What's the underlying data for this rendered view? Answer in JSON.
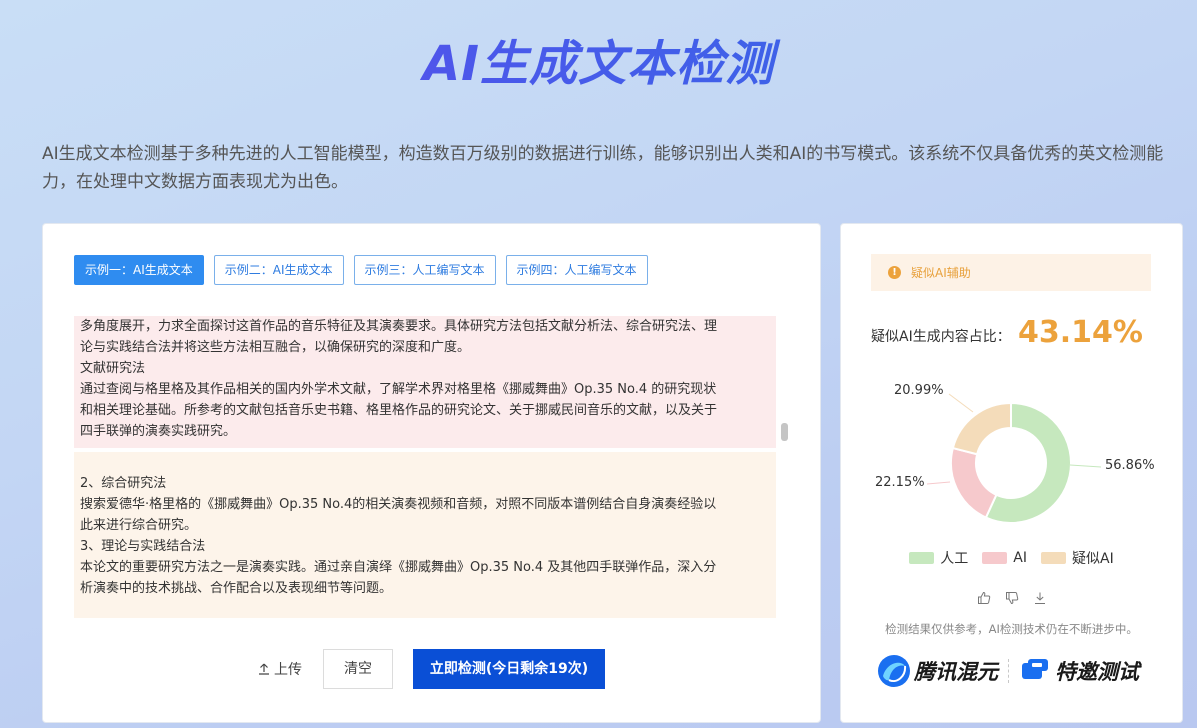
{
  "title": "AI生成文本检测",
  "description": "AI生成文本检测基于多种先进的人工智能模型，构造数百万级别的数据进行训练，能够识别出人类和AI的书写模式。该系统不仅具备优秀的英文检测能力，在处理中文数据方面表现尤为出色。",
  "tabs": [
    "示例一：AI生成文本",
    "示例二：AI生成文本",
    "示例三：人工编写文本",
    "示例四：人工编写文本"
  ],
  "blocks": [
    {
      "type": "ai",
      "lines": [
        "多角度展开，力求全面探讨这首作品的音乐特征及其演奏要求。具体研究方法包括文献分析法、综合研究法、理",
        "论与实践结合法并将这些方法相互融合，以确保研究的深度和广度。",
        "文献研究法",
        "通过查阅与格里格及其作品相关的国内外学术文献，了解学术界对格里格《挪威舞曲》Op.35 No.4 的研究现状",
        "和相关理论基础。所参考的文献包括音乐史书籍、格里格作品的研究论文、关于挪威民间音乐的文献，以及关于",
        "四手联弹的演奏实践研究。"
      ]
    },
    {
      "type": "suspect",
      "lines": [
        "",
        "2、综合研究法",
        "搜索爱德华·格里格的《挪威舞曲》Op.35 No.4的相关演奏视频和音频，对照不同版本谱例结合自身演奏经验以",
        "此来进行综合研究。",
        "3、理论与实践结合法",
        "本论文的重要研究方法之一是演奏实践。通过亲自演绎《挪威舞曲》Op.35 No.4 及其他四手联弹作品，深入分",
        "析演奏中的技术挑战、合作配合以及表现细节等问题。"
      ]
    }
  ],
  "actions": {
    "upload": "上传",
    "clear": "清空",
    "detect": "立即检测(今日剩余19次)"
  },
  "result": {
    "alert": "疑似AI辅助",
    "ratio_label": "疑似AI生成内容占比：",
    "ratio_value": "43.14%",
    "note": "检测结果仅供参考，AI检测技术仍在不断进步中。"
  },
  "chart_data": {
    "type": "pie",
    "donut": true,
    "categories": [
      "人工",
      "AI",
      "疑似AI"
    ],
    "values": [
      56.86,
      22.15,
      20.99
    ],
    "labels": [
      "56.86%",
      "22.15%",
      "20.99%"
    ],
    "colors": [
      "#c6e8be",
      "#f6c9cc",
      "#f4dcba"
    ],
    "legend": "bottom"
  },
  "brands": [
    "腾讯混元",
    "特邀测试"
  ],
  "icons": {
    "upload": "upload-icon",
    "alert": "warning-icon",
    "like": "thumbs-up-icon",
    "dislike": "thumbs-down-icon",
    "download": "download-icon"
  }
}
